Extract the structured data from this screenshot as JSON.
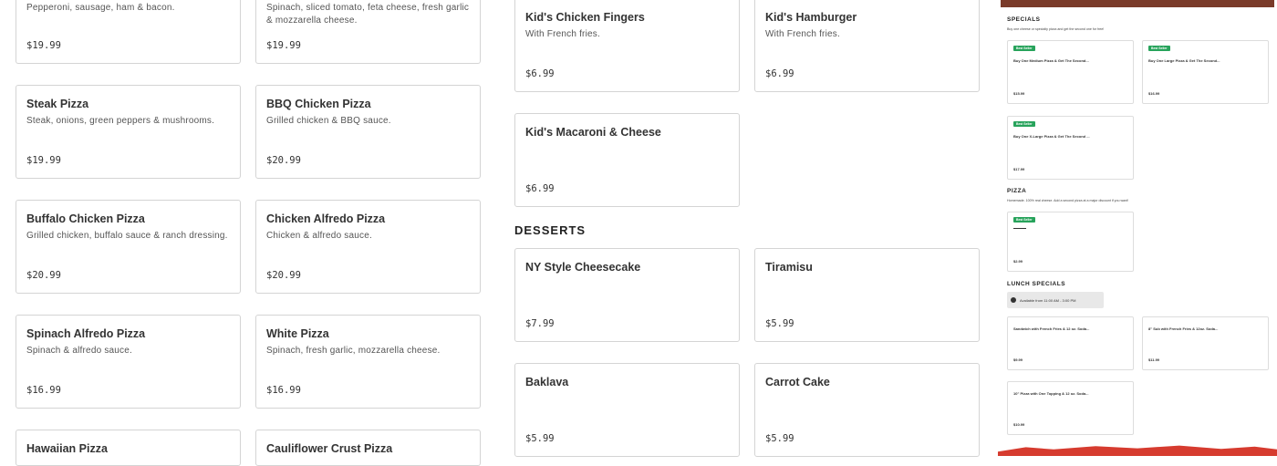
{
  "pizza_col1": [
    {
      "name": "",
      "desc": "Pepperoni, sausage, ham & bacon.",
      "price": "$19.99"
    },
    {
      "name": "Steak Pizza",
      "desc": "Steak, onions, green peppers & mushrooms.",
      "price": "$19.99"
    },
    {
      "name": "Buffalo Chicken Pizza",
      "desc": "Grilled chicken, buffalo sauce & ranch dressing.",
      "price": "$20.99"
    },
    {
      "name": "Spinach Alfredo Pizza",
      "desc": "Spinach & alfredo sauce.",
      "price": "$16.99"
    },
    {
      "name": "Hawaiian Pizza",
      "desc": "",
      "price": ""
    }
  ],
  "pizza_col2": [
    {
      "name": "",
      "desc": "Spinach, sliced tomato, feta cheese, fresh garlic & mozzarella cheese.",
      "price": "$19.99"
    },
    {
      "name": "BBQ Chicken Pizza",
      "desc": "Grilled chicken & BBQ sauce.",
      "price": "$20.99"
    },
    {
      "name": "Chicken Alfredo Pizza",
      "desc": "Chicken & alfredo sauce.",
      "price": "$20.99"
    },
    {
      "name": "White Pizza",
      "desc": "Spinach, fresh garlic, mozzarella cheese.",
      "price": "$16.99"
    },
    {
      "name": "Cauliflower Crust Pizza",
      "desc": "",
      "price": ""
    }
  ],
  "kids": [
    {
      "name": "Kid's Chicken Fingers",
      "desc": "With French fries.",
      "price": "$6.99"
    },
    {
      "name": "Kid's Hamburger",
      "desc": "With French fries.",
      "price": "$6.99"
    },
    {
      "name": "Kid's Macaroni & Cheese",
      "desc": "",
      "price": "$6.99"
    }
  ],
  "desserts_title": "DESSERTS",
  "desserts": [
    {
      "name": "NY Style Cheesecake",
      "price": "$7.99"
    },
    {
      "name": "Tiramisu",
      "price": "$5.99"
    },
    {
      "name": "Baklava",
      "price": "$5.99"
    },
    {
      "name": "Carrot Cake",
      "price": "$5.99"
    }
  ],
  "preview": {
    "specials_title": "SPECIALS",
    "specials_sub": "Buy one cheese or specialty pizza and get the second one for free!",
    "badge": "Best Seller",
    "specials": [
      {
        "name": "Buy One Medium Pizza & Get The Second...",
        "price": "$15.99"
      },
      {
        "name": "Buy One Large Pizza & Get The Second...",
        "price": "$16.99"
      },
      {
        "name": "Buy One X-Large Pizza & Get The Second ...",
        "price": "$17.99"
      }
    ],
    "pizza_title": "PIZZA",
    "pizza_sub": "Homemade. 100% real cheese. Add a second pizza at a major discount if you want!",
    "pizza_item_price": "$2.99",
    "lunch_title": "LUNCH SPECIALS",
    "lunch_avail": "Available from 11:00 AM - 3:00 PM",
    "lunch": [
      {
        "name": "Sandwich with French Fries & 12 oz. Soda...",
        "price": "$9.99"
      },
      {
        "name": "8\" Sub with French Fries & 12oz. Soda...",
        "price": "$11.99"
      },
      {
        "name": "10\" Pizza with One Topping & 12 oz. Soda...",
        "price": "$10.99"
      }
    ]
  }
}
